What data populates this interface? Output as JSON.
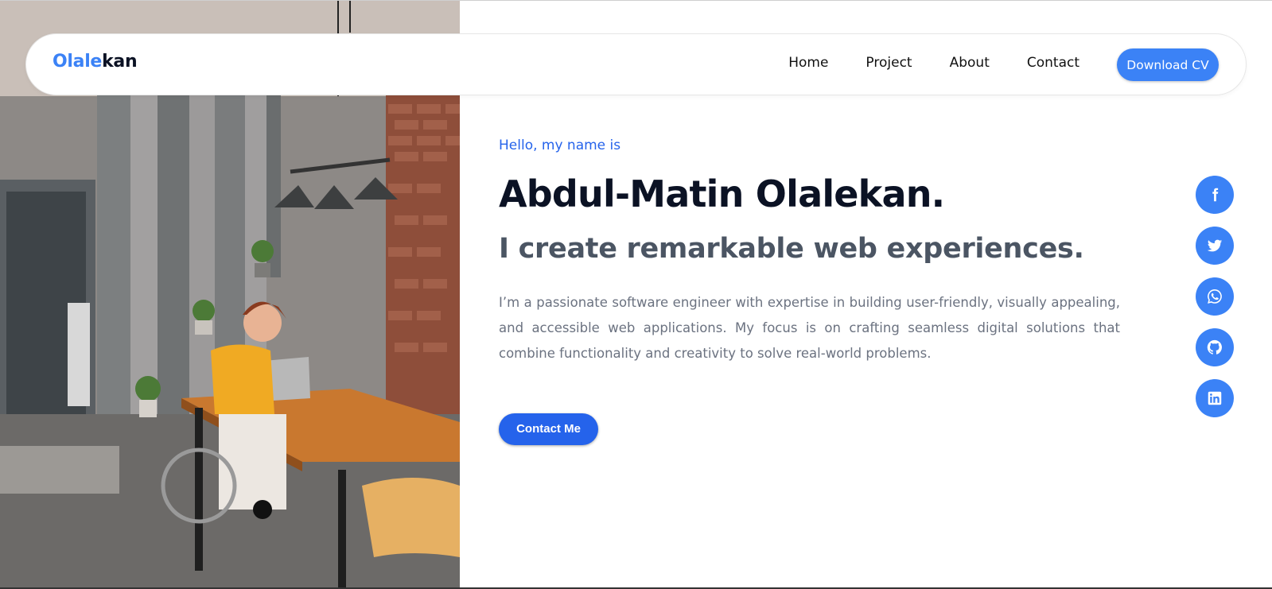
{
  "logo": {
    "part1": "Olale",
    "part2": "kan"
  },
  "nav": {
    "items": [
      "Home",
      "Project",
      "About",
      "Contact"
    ],
    "cta": "Download CV"
  },
  "hero": {
    "greeting": "Hello, my name is",
    "name": "Abdul-Matin Olalekan.",
    "tagline": "I create remarkable web experiences.",
    "bio": "I’m a passionate software engineer with expertise in building user-friendly, visually appealing, and accessible web applications. My focus is on crafting seamless digital solutions that combine functionality and creativity to solve real-world problems.",
    "cta": "Contact Me"
  },
  "social": [
    "facebook-icon",
    "twitter-icon",
    "whatsapp-icon",
    "github-icon",
    "linkedin-icon"
  ],
  "colors": {
    "accent": "#3b82f6",
    "accent_dark": "#2563eb",
    "heading": "#0b1224",
    "muted": "#6b7280"
  }
}
